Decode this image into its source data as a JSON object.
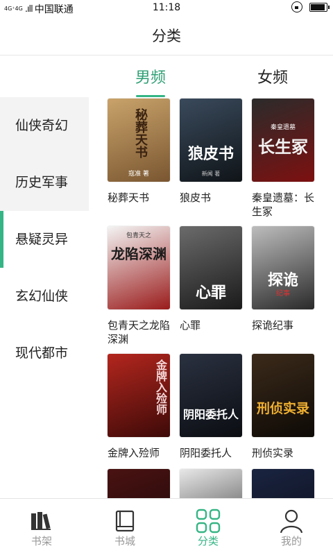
{
  "status_bar": {
    "network": "4G⁺4G",
    "carrier": "中国联通",
    "time": "11:18",
    "battery_level": 0.9
  },
  "header": {
    "title": "分类"
  },
  "gender_tabs": [
    {
      "label": "男频",
      "active": true
    },
    {
      "label": "女频",
      "active": false
    }
  ],
  "categories": [
    {
      "label": "仙侠奇幻",
      "active": false
    },
    {
      "label": "历史军事",
      "active": false
    },
    {
      "label": "悬疑灵异",
      "active": true
    },
    {
      "label": "玄幻仙侠",
      "active": false
    },
    {
      "label": "现代都市",
      "active": false
    }
  ],
  "books": [
    {
      "title": "秘葬天书",
      "cover_text": "秘葬天书",
      "cover_subtext": "寇准 著",
      "cover_colors": [
        "#c9a36a",
        "#7a5631"
      ]
    },
    {
      "title": "狼皮书",
      "cover_text": "狼皮书",
      "cover_subtext": "新闻 著",
      "cover_colors": [
        "#3a4a5c",
        "#0f1418"
      ]
    },
    {
      "title": "秦皇遗墓：长生冢",
      "cover_text": "长生冢",
      "cover_subtext": "秦皇遗墓",
      "cover_colors": [
        "#2b2b2b",
        "#7d1010"
      ]
    },
    {
      "title": "包青天之龙陷深渊",
      "cover_text": "龙陷深渊",
      "cover_subtext": "包青天之",
      "cover_colors": [
        "#f4f4f4",
        "#9a1b1b"
      ]
    },
    {
      "title": "心罪",
      "cover_text": "心罪",
      "cover_subtext": "",
      "cover_colors": [
        "#6b6b6b",
        "#1a1a1a"
      ]
    },
    {
      "title": "探诡纪事",
      "cover_text": "探诡",
      "cover_subtext": "纪事",
      "cover_colors": [
        "#bdbdbd",
        "#2a2a2a"
      ]
    },
    {
      "title": "金牌入殓师",
      "cover_text": "金牌入殓师",
      "cover_subtext": "",
      "cover_colors": [
        "#b3261e",
        "#3d0a08"
      ]
    },
    {
      "title": "阴阳委托人",
      "cover_text": "阴阳委托人",
      "cover_subtext": "",
      "cover_colors": [
        "#2a3140",
        "#0b0d12"
      ]
    },
    {
      "title": "刑侦实录",
      "cover_text": "刑侦实录",
      "cover_subtext": "",
      "cover_colors": [
        "#3b2a1a",
        "#0e0a06"
      ]
    },
    {
      "title": "",
      "cover_text": "",
      "cover_subtext": "",
      "cover_colors": [
        "#4a1212",
        "#1a0808"
      ]
    },
    {
      "title": "",
      "cover_text": "",
      "cover_subtext": "",
      "cover_colors": [
        "#e8e8e8",
        "#2d2d2d"
      ]
    },
    {
      "title": "",
      "cover_text": "",
      "cover_subtext": "",
      "cover_colors": [
        "#1a2440",
        "#0a0c18"
      ]
    }
  ],
  "bottom_nav": [
    {
      "label": "书架",
      "icon": "bookshelf-icon",
      "active": false
    },
    {
      "label": "书城",
      "icon": "book-icon",
      "active": false
    },
    {
      "label": "分类",
      "icon": "category-grid-icon",
      "active": true
    },
    {
      "label": "我的",
      "icon": "profile-icon",
      "active": false
    }
  ],
  "colors": {
    "accent": "#35b585",
    "tab_active_text": "#2e9f74",
    "sidebar_bg": "#f3f3f3"
  }
}
